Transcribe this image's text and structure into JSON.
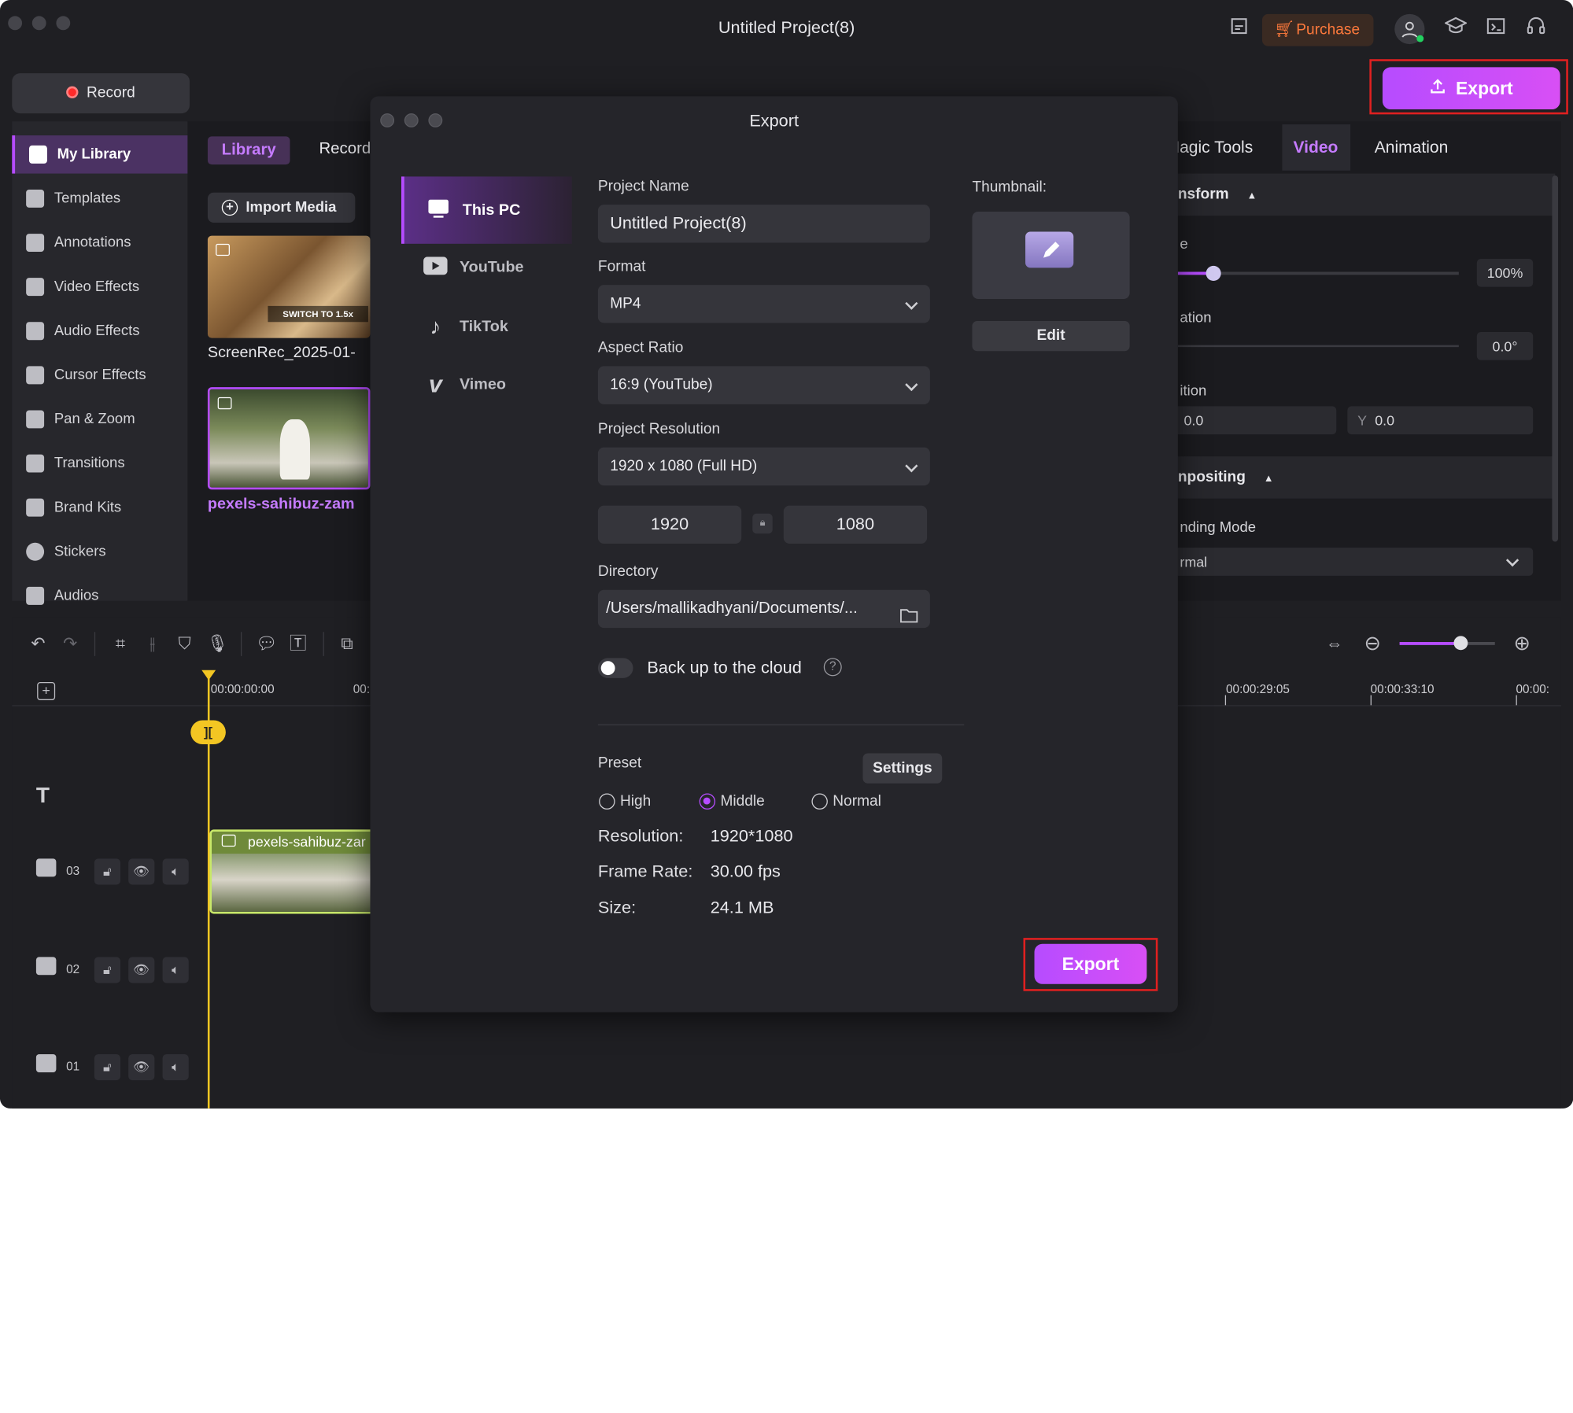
{
  "window": {
    "title": "Untitled Project(8)"
  },
  "topbar": {
    "purchase_label": "Purchase",
    "export_label": "Export"
  },
  "record": {
    "label": "Record"
  },
  "sidebar": {
    "items": [
      {
        "label": "My Library",
        "icon": "layers-icon",
        "active": true
      },
      {
        "label": "Templates",
        "icon": "templates-icon"
      },
      {
        "label": "Annotations",
        "icon": "annotation-icon"
      },
      {
        "label": "Video Effects",
        "icon": "video-effects-icon"
      },
      {
        "label": "Audio Effects",
        "icon": "audio-effects-icon"
      },
      {
        "label": "Cursor Effects",
        "icon": "cursor-icon"
      },
      {
        "label": "Pan & Zoom",
        "icon": "pan-zoom-icon"
      },
      {
        "label": "Transitions",
        "icon": "transitions-icon"
      },
      {
        "label": "Brand Kits",
        "icon": "brand-kit-icon"
      },
      {
        "label": "Stickers",
        "icon": "sticker-icon"
      },
      {
        "label": "Audios",
        "icon": "music-icon"
      }
    ]
  },
  "library": {
    "tabs": [
      "Library",
      "Record"
    ],
    "import_label": "Import Media",
    "media": [
      {
        "name": "ScreenRec_2025-01-",
        "thumb_text": "SWITCH TO 1.5x"
      },
      {
        "name": "pexels-sahibuz-zam"
      }
    ]
  },
  "right_panel": {
    "tabs": [
      "Magic Tools",
      "Video",
      "Animation"
    ],
    "transform_label": "nsform",
    "scale_label": "e",
    "scale_value": "100%",
    "rotation_label": "ation",
    "rotation_value": "0.0°",
    "position_label": "ition",
    "pos_x": "0.0",
    "pos_y_label": "Y",
    "pos_y": "0.0",
    "compositing_label": "npositing",
    "blending_label": "nding Mode",
    "blending_value": "rmal"
  },
  "timeline": {
    "playhead_time": "00:00:00:00",
    "ruler_labels": [
      "00:00:00:00",
      "00:",
      "00:00:29:05",
      "00:00:33:10",
      "00:00:"
    ],
    "clip_name": "pexels-sahibuz-zar",
    "tracks": [
      "03",
      "02",
      "01"
    ]
  },
  "export_dialog": {
    "title": "Export",
    "destinations": [
      {
        "label": "This PC",
        "icon": "monitor-icon",
        "active": true
      },
      {
        "label": "YouTube",
        "icon": "youtube-icon"
      },
      {
        "label": "TikTok",
        "icon": "tiktok-icon"
      },
      {
        "label": "Vimeo",
        "icon": "vimeo-icon"
      }
    ],
    "project_name_label": "Project Name",
    "project_name": "Untitled Project(8)",
    "format_label": "Format",
    "format": "MP4",
    "aspect_label": "Aspect Ratio",
    "aspect": "16:9 (YouTube)",
    "resolution_label": "Project Resolution",
    "resolution": "1920 x 1080 (Full HD)",
    "width": "1920",
    "height": "1080",
    "directory_label": "Directory",
    "directory": "/Users/mallikadhyani/Documents/...",
    "cloud_label": "Back up to the cloud",
    "thumbnail_label": "Thumbnail:",
    "edit_label": "Edit",
    "preset_label": "Preset",
    "settings_label": "Settings",
    "presets": [
      "High",
      "Middle",
      "Normal"
    ],
    "preset_selected": "Middle",
    "info": [
      {
        "label": "Resolution:",
        "value": "1920*1080"
      },
      {
        "label": "Frame Rate:",
        "value": "30.00 fps"
      },
      {
        "label": "Size:",
        "value": "24.1 MB"
      }
    ],
    "export_label": "Export"
  }
}
